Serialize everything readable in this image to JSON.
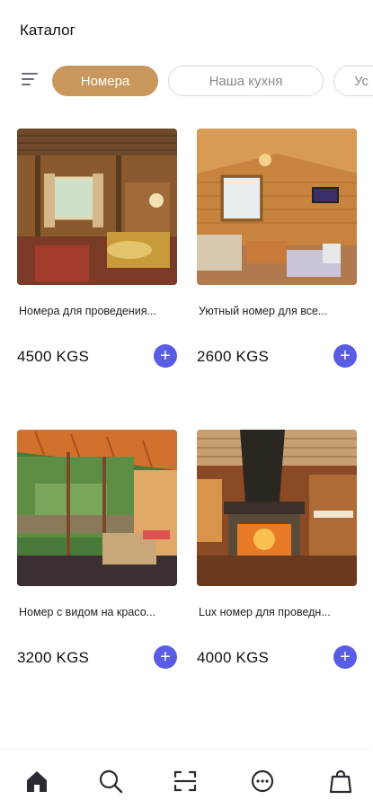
{
  "header": {
    "title": "Каталог"
  },
  "filters": {
    "icon": "filter-list-icon",
    "chips": [
      "Номера",
      "Наша кухня",
      "Ус"
    ]
  },
  "products": [
    {
      "title": "Номера для проведения...",
      "price": "4500 KGS"
    },
    {
      "title": "Уютный номер для все...",
      "price": "2600 KGS"
    },
    {
      "title": "Номер с видом на красо...",
      "price": "3200 KGS"
    },
    {
      "title": "Lux номер для проведн...",
      "price": "4000 KGS"
    }
  ],
  "add_label": "+",
  "colors": {
    "accent_chip": "#c9975b",
    "add_button": "#5b5ce6"
  },
  "nav": [
    "home-icon",
    "search-icon",
    "scan-icon",
    "chat-icon",
    "bag-icon"
  ]
}
